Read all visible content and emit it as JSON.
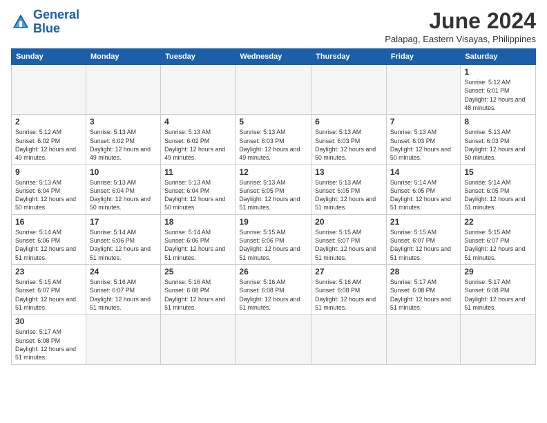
{
  "header": {
    "logo_line1": "General",
    "logo_line2": "Blue",
    "month_title": "June 2024",
    "subtitle": "Palapag, Eastern Visayas, Philippines"
  },
  "weekdays": [
    "Sunday",
    "Monday",
    "Tuesday",
    "Wednesday",
    "Thursday",
    "Friday",
    "Saturday"
  ],
  "weeks": [
    [
      {
        "day": "",
        "empty": true
      },
      {
        "day": "",
        "empty": true
      },
      {
        "day": "",
        "empty": true
      },
      {
        "day": "",
        "empty": true
      },
      {
        "day": "",
        "empty": true
      },
      {
        "day": "",
        "empty": true
      },
      {
        "day": "1",
        "sunrise": "5:12 AM",
        "sunset": "6:01 PM",
        "daylight": "12 hours and 48 minutes."
      }
    ],
    [
      {
        "day": "2",
        "sunrise": "5:12 AM",
        "sunset": "6:02 PM",
        "daylight": "12 hours and 49 minutes."
      },
      {
        "day": "3",
        "sunrise": "5:13 AM",
        "sunset": "6:02 PM",
        "daylight": "12 hours and 49 minutes."
      },
      {
        "day": "4",
        "sunrise": "5:13 AM",
        "sunset": "6:02 PM",
        "daylight": "12 hours and 49 minutes."
      },
      {
        "day": "5",
        "sunrise": "5:13 AM",
        "sunset": "6:03 PM",
        "daylight": "12 hours and 49 minutes."
      },
      {
        "day": "6",
        "sunrise": "5:13 AM",
        "sunset": "6:03 PM",
        "daylight": "12 hours and 50 minutes."
      },
      {
        "day": "7",
        "sunrise": "5:13 AM",
        "sunset": "6:03 PM",
        "daylight": "12 hours and 50 minutes."
      },
      {
        "day": "8",
        "sunrise": "5:13 AM",
        "sunset": "6:03 PM",
        "daylight": "12 hours and 50 minutes."
      }
    ],
    [
      {
        "day": "9",
        "sunrise": "5:13 AM",
        "sunset": "6:04 PM",
        "daylight": "12 hours and 50 minutes."
      },
      {
        "day": "10",
        "sunrise": "5:13 AM",
        "sunset": "6:04 PM",
        "daylight": "12 hours and 50 minutes."
      },
      {
        "day": "11",
        "sunrise": "5:13 AM",
        "sunset": "6:04 PM",
        "daylight": "12 hours and 50 minutes."
      },
      {
        "day": "12",
        "sunrise": "5:13 AM",
        "sunset": "6:05 PM",
        "daylight": "12 hours and 51 minutes."
      },
      {
        "day": "13",
        "sunrise": "5:13 AM",
        "sunset": "6:05 PM",
        "daylight": "12 hours and 51 minutes."
      },
      {
        "day": "14",
        "sunrise": "5:14 AM",
        "sunset": "6:05 PM",
        "daylight": "12 hours and 51 minutes."
      },
      {
        "day": "15",
        "sunrise": "5:14 AM",
        "sunset": "6:05 PM",
        "daylight": "12 hours and 51 minutes."
      }
    ],
    [
      {
        "day": "16",
        "sunrise": "5:14 AM",
        "sunset": "6:06 PM",
        "daylight": "12 hours and 51 minutes."
      },
      {
        "day": "17",
        "sunrise": "5:14 AM",
        "sunset": "6:06 PM",
        "daylight": "12 hours and 51 minutes."
      },
      {
        "day": "18",
        "sunrise": "5:14 AM",
        "sunset": "6:06 PM",
        "daylight": "12 hours and 51 minutes."
      },
      {
        "day": "19",
        "sunrise": "5:15 AM",
        "sunset": "6:06 PM",
        "daylight": "12 hours and 51 minutes."
      },
      {
        "day": "20",
        "sunrise": "5:15 AM",
        "sunset": "6:07 PM",
        "daylight": "12 hours and 51 minutes."
      },
      {
        "day": "21",
        "sunrise": "5:15 AM",
        "sunset": "6:07 PM",
        "daylight": "12 hours and 51 minutes."
      },
      {
        "day": "22",
        "sunrise": "5:15 AM",
        "sunset": "6:07 PM",
        "daylight": "12 hours and 51 minutes."
      }
    ],
    [
      {
        "day": "23",
        "sunrise": "5:15 AM",
        "sunset": "6:07 PM",
        "daylight": "12 hours and 51 minutes."
      },
      {
        "day": "24",
        "sunrise": "5:16 AM",
        "sunset": "6:07 PM",
        "daylight": "12 hours and 51 minutes."
      },
      {
        "day": "25",
        "sunrise": "5:16 AM",
        "sunset": "6:08 PM",
        "daylight": "12 hours and 51 minutes."
      },
      {
        "day": "26",
        "sunrise": "5:16 AM",
        "sunset": "6:08 PM",
        "daylight": "12 hours and 51 minutes."
      },
      {
        "day": "27",
        "sunrise": "5:16 AM",
        "sunset": "6:08 PM",
        "daylight": "12 hours and 51 minutes."
      },
      {
        "day": "28",
        "sunrise": "5:17 AM",
        "sunset": "6:08 PM",
        "daylight": "12 hours and 51 minutes."
      },
      {
        "day": "29",
        "sunrise": "5:17 AM",
        "sunset": "6:08 PM",
        "daylight": "12 hours and 51 minutes."
      }
    ],
    [
      {
        "day": "30",
        "sunrise": "5:17 AM",
        "sunset": "6:08 PM",
        "daylight": "12 hours and 51 minutes."
      },
      {
        "day": "",
        "empty": true
      },
      {
        "day": "",
        "empty": true
      },
      {
        "day": "",
        "empty": true
      },
      {
        "day": "",
        "empty": true
      },
      {
        "day": "",
        "empty": true
      },
      {
        "day": "",
        "empty": true
      }
    ]
  ]
}
